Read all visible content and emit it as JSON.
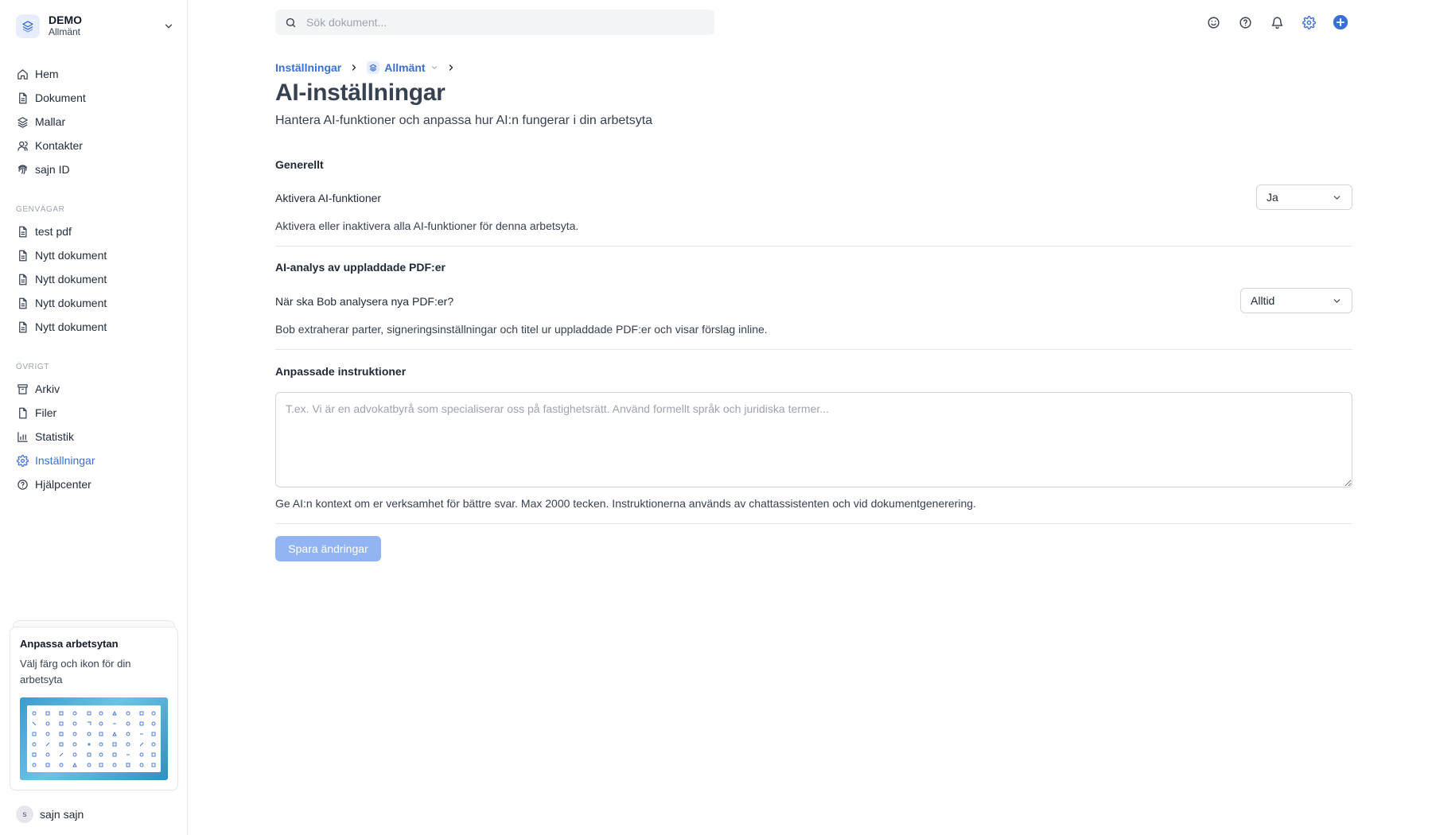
{
  "workspace": {
    "name": "DEMO",
    "subtitle": "Allmänt"
  },
  "nav": {
    "main": [
      {
        "label": "Hem",
        "icon": "home-icon"
      },
      {
        "label": "Dokument",
        "icon": "document-icon"
      },
      {
        "label": "Mallar",
        "icon": "layers-icon"
      },
      {
        "label": "Kontakter",
        "icon": "user-icon"
      },
      {
        "label": "sajn ID",
        "icon": "fingerprint-icon"
      }
    ],
    "shortcuts_title": "GENVÄGAR",
    "shortcuts": [
      {
        "label": "test pdf"
      },
      {
        "label": "Nytt dokument"
      },
      {
        "label": "Nytt dokument"
      },
      {
        "label": "Nytt dokument"
      },
      {
        "label": "Nytt dokument"
      }
    ],
    "other_title": "ÖVRIGT",
    "other": [
      {
        "label": "Arkiv",
        "icon": "archive-icon"
      },
      {
        "label": "Filer",
        "icon": "file-icon"
      },
      {
        "label": "Statistik",
        "icon": "chart-icon"
      },
      {
        "label": "Inställningar",
        "icon": "gear-icon",
        "active": true
      },
      {
        "label": "Hjälpcenter",
        "icon": "help-icon"
      }
    ]
  },
  "promo": {
    "title": "Anpassa arbetsytan",
    "text": "Välj färg och ikon för din arbetsyta"
  },
  "user": {
    "initial": "s",
    "name": "sajn sajn"
  },
  "search": {
    "placeholder": "Sök dokument..."
  },
  "breadcrumb": {
    "first": "Inställningar",
    "second": "Allmänt"
  },
  "page": {
    "title": "AI-inställningar",
    "subtitle": "Hantera AI-funktioner och anpassa hur AI:n fungerar i din arbetsyta"
  },
  "general": {
    "heading": "Generellt",
    "label": "Aktivera AI-funktioner",
    "value": "Ja",
    "description": "Aktivera eller inaktivera alla AI-funktioner för denna arbetsyta."
  },
  "pdf": {
    "heading": "AI-analys av uppladdade PDF:er",
    "label": "När ska Bob analysera nya PDF:er?",
    "value": "Alltid",
    "description": "Bob extraherar parter, signeringsinställningar och titel ur uppladdade PDF:er och visar förslag inline."
  },
  "instructions": {
    "heading": "Anpassade instruktioner",
    "placeholder": "T.ex. Vi är en advokatbyrå som specialiserar oss på fastighetsrätt. Använd formellt språk och juridiska termer...",
    "value": "",
    "description": "Ge AI:n kontext om er verksamhet för bättre svar. Max 2000 tecken. Instruktionerna används av chattassistenten och vid dokumentgenerering."
  },
  "save_label": "Spara ändringar",
  "colors": {
    "accent": "#3b6fd6",
    "disabled_button": "#93b4f2"
  }
}
